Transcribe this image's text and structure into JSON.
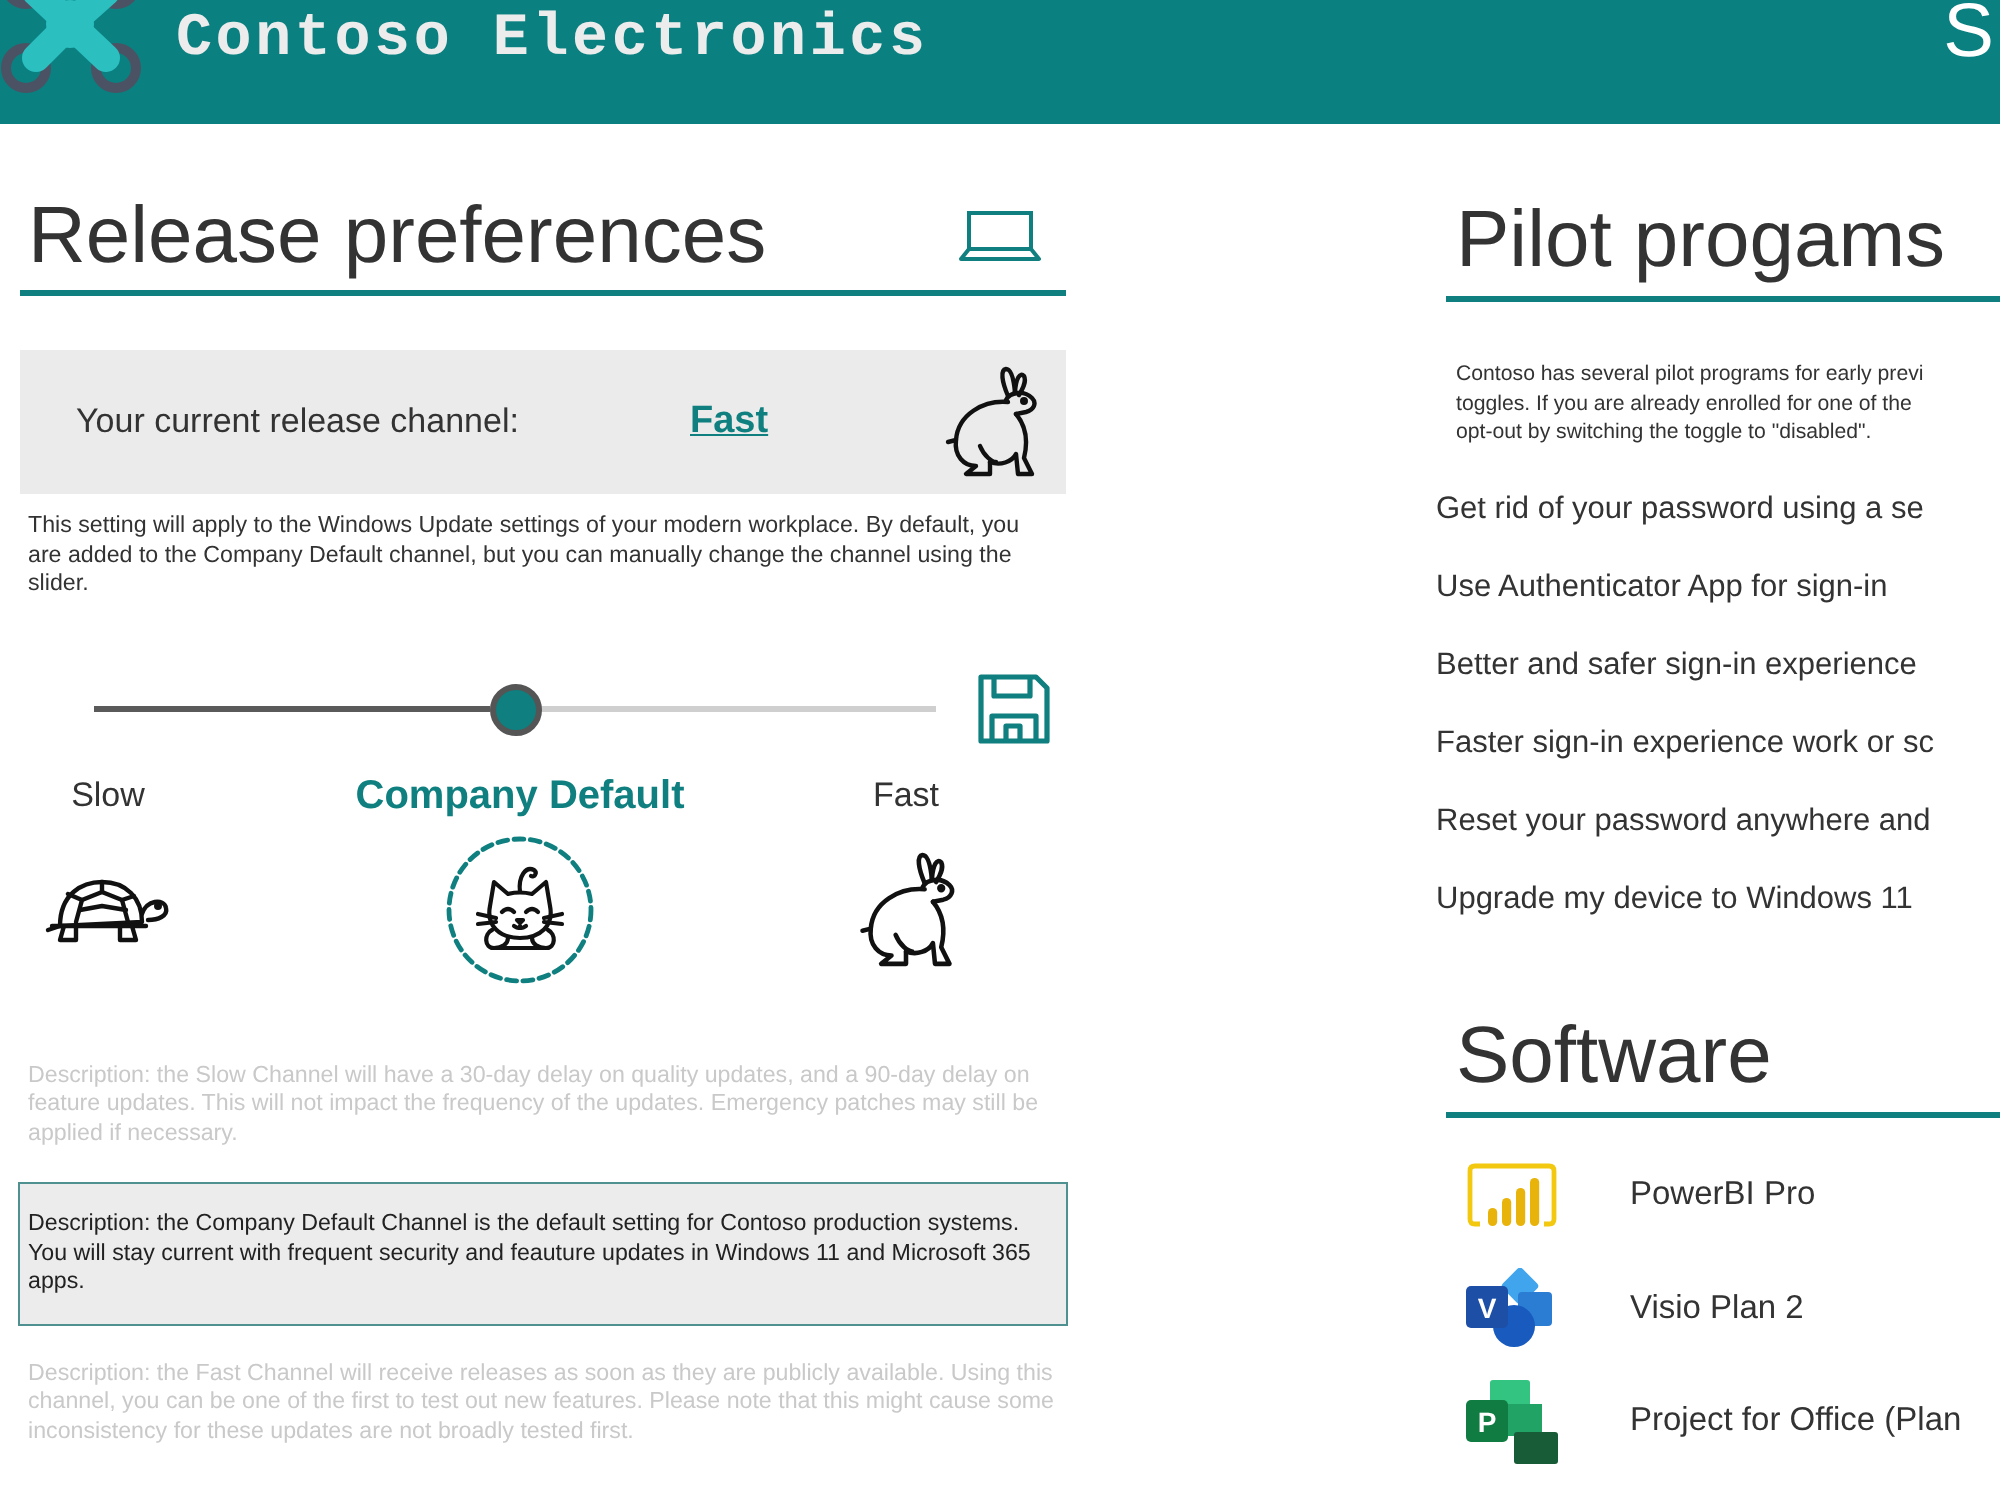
{
  "header": {
    "title": "Contoso Electronics",
    "right_text": "S"
  },
  "release_preferences": {
    "title": "Release preferences",
    "current_channel": {
      "label": "Your current release channel:",
      "value": "Fast"
    },
    "intro": "This setting will apply to the Windows Update settings of your modern workplace. By default, you are added to the Company Default channel, but you can manually change the channel using the slider.",
    "slider": {
      "level": 0.5
    },
    "channels": [
      {
        "kind": "slow",
        "label": "Slow",
        "selected": false,
        "description": "Description: the Slow Channel will have a 30-day delay on quality updates, and a 90-day delay on feature updates. This will not impact the frequency of the updates. Emergency patches may still be applied if necessary."
      },
      {
        "kind": "company-default",
        "label": "Company Default",
        "selected": true,
        "description": "Description: the Company Default Channel is the default setting for Contoso production systems. You will stay current with frequent security and feauture updates in Windows 11 and Microsoft 365 apps."
      },
      {
        "kind": "fast",
        "label": "Fast",
        "selected": false,
        "description": "Description: the Fast Channel will receive releases as soon as they are publicly available. Using this channel, you can be one of the first to test out new features. Please note that this might cause some inconsistency for these updates are not broadly tested first."
      }
    ]
  },
  "pilot_programs": {
    "title": "Pilot progams",
    "description_lines": [
      "Contoso has several pilot programs for early previ",
      "toggles. If you are already enrolled for one of the",
      "opt-out by switching the toggle to \"disabled\"."
    ],
    "items": [
      "Get rid of your password using a se",
      "Use Authenticator App for sign-in",
      "Better and safer sign-in experience",
      "Faster sign-in experience work or sc",
      "Reset your password anywhere and",
      "Upgrade my device to Windows 11"
    ]
  },
  "software": {
    "title": "Software",
    "items": [
      {
        "kind": "powerbi",
        "name": "PowerBI Pro"
      },
      {
        "kind": "visio",
        "icon_letter": "V",
        "name": "Visio Plan 2"
      },
      {
        "kind": "project",
        "icon_letter": "P",
        "name": "Project for Office (Plan"
      }
    ]
  }
}
